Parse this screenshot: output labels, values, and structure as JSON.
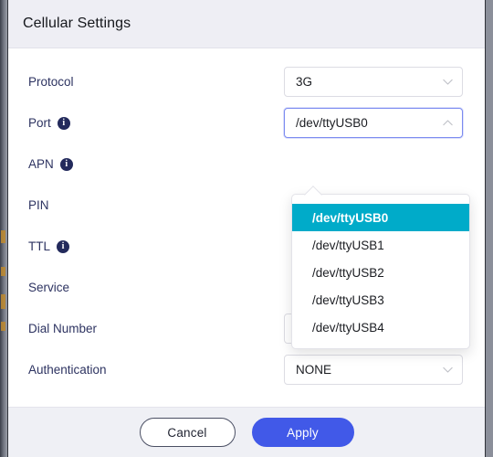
{
  "window": {
    "title": "Cellular Settings"
  },
  "form": {
    "rows": [
      {
        "label": "Protocol",
        "info": false,
        "control": "select",
        "value": "3G",
        "state": "closed"
      },
      {
        "label": "Port",
        "info": true,
        "control": "select",
        "value": "/dev/ttyUSB0",
        "state": "open"
      },
      {
        "label": "APN",
        "info": true,
        "control": "text",
        "value": "",
        "state": "hidden"
      },
      {
        "label": "PIN",
        "info": false,
        "control": "text",
        "value": "",
        "state": "hidden"
      },
      {
        "label": "TTL",
        "info": true,
        "control": "text",
        "value": "",
        "state": "hidden"
      },
      {
        "label": "Service",
        "info": false,
        "control": "text",
        "value": "",
        "state": "hidden"
      },
      {
        "label": "Dial Number",
        "info": false,
        "control": "text",
        "value": "",
        "state": "closed"
      },
      {
        "label": "Authentication",
        "info": false,
        "control": "select",
        "value": "NONE",
        "state": "closed"
      }
    ]
  },
  "port_dropdown": {
    "options": [
      {
        "label": "/dev/ttyUSB0",
        "selected": true
      },
      {
        "label": "/dev/ttyUSB1",
        "selected": false
      },
      {
        "label": "/dev/ttyUSB2",
        "selected": false
      },
      {
        "label": "/dev/ttyUSB3",
        "selected": false
      },
      {
        "label": "/dev/ttyUSB4",
        "selected": false
      }
    ]
  },
  "footer": {
    "cancel_label": "Cancel",
    "apply_label": "Apply"
  },
  "icons": {
    "info": "i",
    "chevron_down": "chevron-down-icon",
    "chevron_up": "chevron-up-icon"
  },
  "colors": {
    "accent_blue": "#4159e8",
    "highlight_teal": "#00abc9",
    "label_navy": "#2d3361",
    "info_badge": "#232a5c",
    "header_bg": "#eeeef4",
    "footer_bg": "#eff0f5",
    "focus_border": "#7b8af0"
  }
}
